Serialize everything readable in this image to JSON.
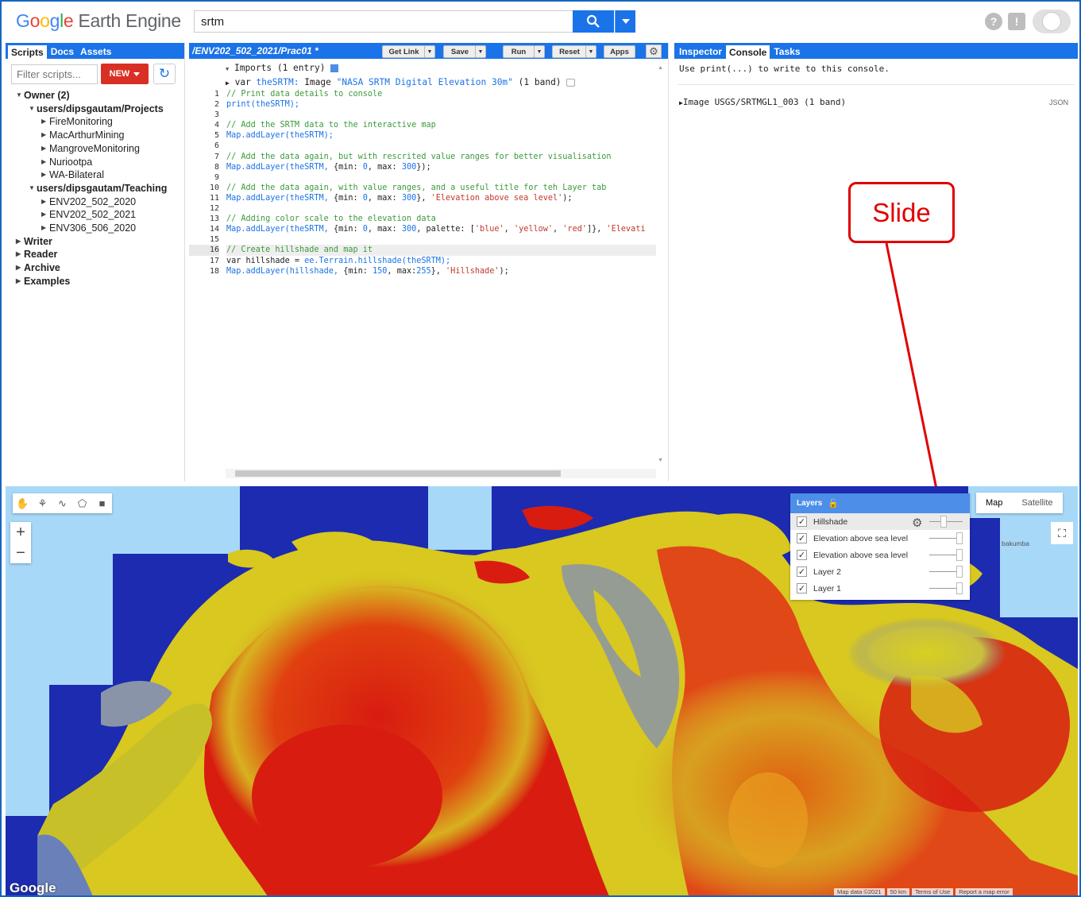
{
  "header": {
    "logo_google": [
      "G",
      "o",
      "o",
      "g",
      "l",
      "e"
    ],
    "logo_product": " Earth Engine",
    "search_value": "srtm",
    "help_icon": "question-icon",
    "feedback_icon": "feedback-icon"
  },
  "left_panel": {
    "tabs": [
      "Scripts",
      "Docs",
      "Assets"
    ],
    "filter_placeholder": "Filter scripts...",
    "new_label": "NEW",
    "tree": [
      {
        "label": "Owner (2)",
        "level": 0,
        "bold": true,
        "arrow": "down"
      },
      {
        "label": "users/dipsgautam/Projects",
        "level": 1,
        "bold": true,
        "arrow": "down"
      },
      {
        "label": "FireMonitoring",
        "level": 2,
        "bold": false,
        "arrow": "right"
      },
      {
        "label": "MacArthurMining",
        "level": 2,
        "bold": false,
        "arrow": "right"
      },
      {
        "label": "MangroveMonitoring",
        "level": 2,
        "bold": false,
        "arrow": "right"
      },
      {
        "label": "Nuriootpa",
        "level": 2,
        "bold": false,
        "arrow": "right"
      },
      {
        "label": "WA-Bilateral",
        "level": 2,
        "bold": false,
        "arrow": "right"
      },
      {
        "label": "users/dipsgautam/Teaching",
        "level": 1,
        "bold": true,
        "arrow": "down"
      },
      {
        "label": "ENV202_502_2020",
        "level": 2,
        "bold": false,
        "arrow": "right"
      },
      {
        "label": "ENV202_502_2021",
        "level": 2,
        "bold": false,
        "arrow": "right"
      },
      {
        "label": "ENV306_506_2020",
        "level": 2,
        "bold": false,
        "arrow": "right"
      },
      {
        "label": "Writer",
        "level": 0,
        "bold": true,
        "arrow": "right"
      },
      {
        "label": "Reader",
        "level": 0,
        "bold": true,
        "arrow": "right"
      },
      {
        "label": "Archive",
        "level": 0,
        "bold": true,
        "arrow": "right"
      },
      {
        "label": "Examples",
        "level": 0,
        "bold": true,
        "arrow": "right"
      }
    ]
  },
  "editor": {
    "title": "/ENV202_502_2021/Prac01 *",
    "buttons": {
      "get_link": "Get Link",
      "save": "Save",
      "run": "Run",
      "reset": "Reset",
      "apps": "Apps"
    },
    "imports_header": "Imports (1 entry)",
    "import_var_kw": "var",
    "import_var_name": "theSRTM:",
    "import_type": "Image",
    "import_desc": "\"NASA SRTM Digital Elevation 30m\"",
    "import_bands": "(1 band)",
    "line_numbers": [
      "1",
      "2",
      "3",
      "4",
      "5",
      "6",
      "7",
      "8",
      "9",
      "10",
      "11",
      "12",
      "13",
      "14",
      "15",
      "16",
      "17",
      "18"
    ],
    "highlighted_line": 16,
    "lines": [
      [
        {
          "t": "// Print data details to console",
          "c": "cm"
        }
      ],
      [
        {
          "t": "print",
          "c": "fn"
        },
        {
          "t": "(theSRTM);",
          "c": "fn"
        }
      ],
      [],
      [
        {
          "t": "// Add the SRTM data to the interactive map",
          "c": "cm"
        }
      ],
      [
        {
          "t": "Map.addLayer(theSRTM);",
          "c": "fn"
        }
      ],
      [],
      [
        {
          "t": "// Add the data again, but with rescrited value ranges for better visualisation",
          "c": "cm"
        }
      ],
      [
        {
          "t": "Map.addLayer(theSRTM, ",
          "c": "fn"
        },
        {
          "t": "{min: ",
          "c": "pl"
        },
        {
          "t": "0",
          "c": "nm"
        },
        {
          "t": ", max: ",
          "c": "pl"
        },
        {
          "t": "300",
          "c": "nm"
        },
        {
          "t": "});",
          "c": "pl"
        }
      ],
      [],
      [
        {
          "t": "// Add the data again, with value ranges, and a useful title for teh Layer tab",
          "c": "cm"
        }
      ],
      [
        {
          "t": "Map.addLayer(theSRTM, ",
          "c": "fn"
        },
        {
          "t": "{min: ",
          "c": "pl"
        },
        {
          "t": "0",
          "c": "nm"
        },
        {
          "t": ", max: ",
          "c": "pl"
        },
        {
          "t": "300",
          "c": "nm"
        },
        {
          "t": "}, ",
          "c": "pl"
        },
        {
          "t": "'Elevation above sea level'",
          "c": "sr"
        },
        {
          "t": ");",
          "c": "pl"
        }
      ],
      [],
      [
        {
          "t": "// Adding color scale to the elevation data",
          "c": "cm"
        }
      ],
      [
        {
          "t": "Map.addLayer(theSRTM, ",
          "c": "fn"
        },
        {
          "t": "{min: ",
          "c": "pl"
        },
        {
          "t": "0",
          "c": "nm"
        },
        {
          "t": ", max: ",
          "c": "pl"
        },
        {
          "t": "300",
          "c": "nm"
        },
        {
          "t": ", palette: [",
          "c": "pl"
        },
        {
          "t": "'blue'",
          "c": "sr"
        },
        {
          "t": ", ",
          "c": "pl"
        },
        {
          "t": "'yellow'",
          "c": "sr"
        },
        {
          "t": ", ",
          "c": "pl"
        },
        {
          "t": "'red'",
          "c": "sr"
        },
        {
          "t": "]}, ",
          "c": "pl"
        },
        {
          "t": "'Elevati",
          "c": "sr"
        }
      ],
      [],
      [
        {
          "t": "// Create hillshade and map it",
          "c": "cm"
        }
      ],
      [
        {
          "t": "var hillshade = ",
          "c": "pl"
        },
        {
          "t": "ee.Terrain.hillshade(theSRTM);",
          "c": "fn"
        }
      ],
      [
        {
          "t": "Map.addLayer(hillshade, ",
          "c": "fn"
        },
        {
          "t": "{min: ",
          "c": "pl"
        },
        {
          "t": "150",
          "c": "nm"
        },
        {
          "t": ", max:",
          "c": "pl"
        },
        {
          "t": "255",
          "c": "nm"
        },
        {
          "t": "}, ",
          "c": "pl"
        },
        {
          "t": "'Hillshade'",
          "c": "sr"
        },
        {
          "t": ");",
          "c": "pl"
        }
      ]
    ]
  },
  "right_panel": {
    "tabs": [
      "Inspector",
      "Console",
      "Tasks"
    ],
    "active_tab": "Console",
    "console_hint": "Use print(...) to write to this console.",
    "console_entry": "Image USGS/SRTMGL1_003 (1 band)",
    "console_entry_json": "JSON",
    "annotation": "Slide"
  },
  "map": {
    "layers_title": "Layers",
    "layers": [
      {
        "name": "Hillshade",
        "checked": true,
        "opacity": 0.4
      },
      {
        "name": "Elevation above sea level",
        "checked": true,
        "opacity": 1
      },
      {
        "name": "Elevation above sea level",
        "checked": true,
        "opacity": 1
      },
      {
        "name": "Layer 2",
        "checked": true,
        "opacity": 1
      },
      {
        "name": "Layer 1",
        "checked": true,
        "opacity": 1
      }
    ],
    "map_type_options": [
      "Map",
      "Satellite"
    ],
    "active_map_type": "Map",
    "place_label": "bakumba",
    "watermark": "Google",
    "attribution": [
      "Map data ©2021",
      "50 km",
      "Terms of Use",
      "Report a map error"
    ],
    "palette": {
      "water": "#a8d8f8",
      "low": "#1c2bb0",
      "mid": "#d8d020",
      "high": "#d81c10"
    }
  }
}
